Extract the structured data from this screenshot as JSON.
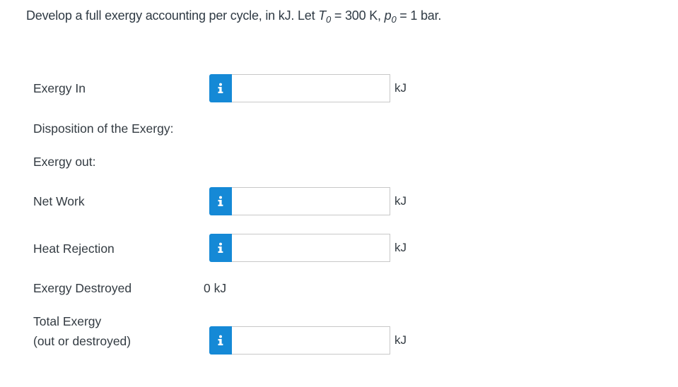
{
  "question": {
    "prefix": "Develop a full exergy accounting per cycle, in kJ. Let ",
    "t_var": "T",
    "t_sub": "0",
    "t_value": " = 300 K, ",
    "p_var": "p",
    "p_sub": "0",
    "p_value": " = 1 bar."
  },
  "rows": {
    "exergy_in": {
      "label": "Exergy In",
      "value": "",
      "unit": "kJ"
    },
    "disposition_heading": "Disposition of the Exergy:",
    "exergy_out_heading": "Exergy out:",
    "net_work": {
      "label": "Net Work",
      "value": "",
      "unit": "kJ"
    },
    "heat_rejection": {
      "label": "Heat Rejection",
      "value": "",
      "unit": "kJ"
    },
    "exergy_destroyed": {
      "label": "Exergy Destroyed",
      "value": "0 kJ"
    },
    "total_exergy": {
      "label_line1": "Total Exergy",
      "label_line2": "(out or destroyed)",
      "value": "",
      "unit": "kJ"
    }
  },
  "colors": {
    "info_button": "#1589d6",
    "input_border": "#c8c8c8",
    "text": "#333b42"
  },
  "icons": {
    "info": "info-icon"
  }
}
